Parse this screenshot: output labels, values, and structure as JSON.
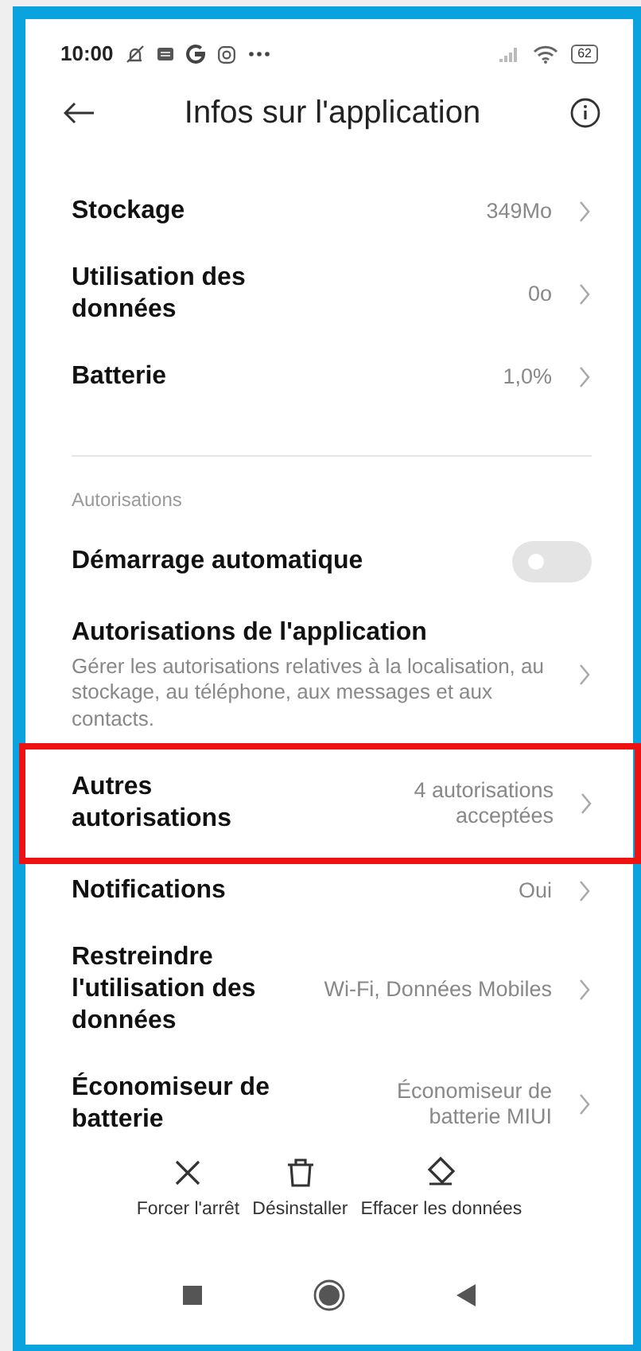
{
  "status_bar": {
    "time": "10:00",
    "battery": "62"
  },
  "header": {
    "title": "Infos sur l'application"
  },
  "sections": [
    {
      "rows": [
        {
          "kind": "value",
          "label": "Stockage",
          "value": "349Mo",
          "highlighted": false
        },
        {
          "kind": "value",
          "label": "Utilisation des données",
          "value": "0o",
          "highlighted": false
        },
        {
          "kind": "value",
          "label": "Batterie",
          "value": "1,0%",
          "highlighted": false
        }
      ]
    },
    {
      "label": "Autorisations",
      "rows": [
        {
          "kind": "toggle",
          "label": "Démarrage automatique",
          "on": false
        },
        {
          "kind": "description",
          "label": "Autorisations de l'application",
          "description": "Gérer les autorisations relatives à la localisation, au stockage, au téléphone, aux messages et aux contacts."
        },
        {
          "kind": "value",
          "label": "Autres autorisations",
          "value": "4 autorisations acceptées",
          "highlighted": true
        },
        {
          "kind": "value",
          "label": "Notifications",
          "value": "Oui",
          "highlighted": false
        },
        {
          "kind": "value",
          "label": "Restreindre l'utilisation des données",
          "value": "Wi-Fi, Données Mobiles",
          "highlighted": false
        },
        {
          "kind": "value",
          "label": "Économiseur de batterie",
          "value": "Économiseur de batterie MIUI",
          "highlighted": false
        }
      ]
    }
  ],
  "actions": [
    {
      "kind": "stop",
      "label": "Forcer l'arrêt"
    },
    {
      "kind": "uninstall",
      "label": "Désinstaller"
    },
    {
      "kind": "clear",
      "label": "Effacer les données"
    }
  ]
}
